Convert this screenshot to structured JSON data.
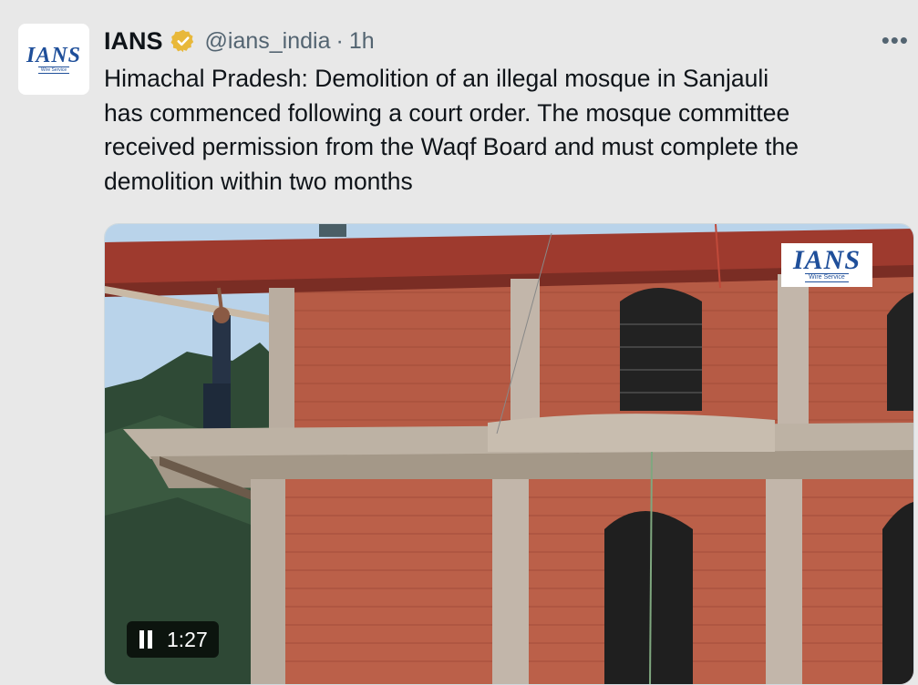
{
  "tweet": {
    "author_name": "IANS",
    "handle": "@ians_india",
    "separator": "·",
    "time": "1h",
    "text": "Himachal Pradesh: Demolition of an illegal mosque in Sanjauli\nhas commenced following a court order. The mosque committee\nreceived permission from the Waqf Board and must complete the\ndemolition within two months",
    "more_label": "•••"
  },
  "avatar": {
    "logo_text": "IANS",
    "logo_subtext": "Wire Service"
  },
  "media": {
    "watermark_text": "IANS",
    "watermark_subtext": "Wire Service",
    "duration": "1:27"
  },
  "icons": {
    "verified": "verified-badge-icon",
    "more": "more-options-icon",
    "pause": "pause-icon"
  },
  "colors": {
    "background": "#e8e8e8",
    "verified_badge": "#e8b83a",
    "brand_blue": "#1f4f9a",
    "secondary_text": "#536471"
  }
}
